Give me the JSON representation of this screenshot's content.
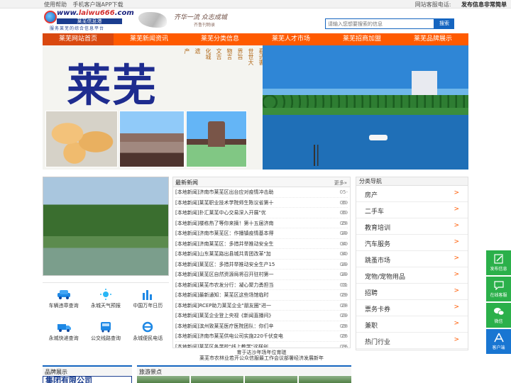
{
  "topbar": {
    "links": [
      "使用帮助",
      "手机客户端APP下载"
    ],
    "service_phone": "网站客服电话:",
    "post_info": "发布信息非常简单"
  },
  "logo": {
    "url_prefix": "www.",
    "url_domain": "laiwu666",
    "url_suffix": ".com",
    "name": "莱芜信息港",
    "slogan": "服务莱芜的综合信息平台"
  },
  "header_calligraphy": {
    "line1": "齐华一流 众志成城",
    "line2": "齐鲁刊物录"
  },
  "search": {
    "placeholder": "请输入您想要搜索的信息",
    "button": "搜索"
  },
  "nav": [
    "莱芜网站首页",
    "莱芜新闻资讯",
    "莱芜分类信息",
    "莱芜人才市场",
    "莱芜招商加盟",
    "莱芜品牌展示"
  ],
  "banner": {
    "title": "莱芜",
    "poem_columns": [
      "看诗書",
      "世世大",
      "界旨",
      "物言",
      "文吉",
      "化城",
      "遗",
      "产"
    ]
  },
  "services": [
    {
      "label": "车辆违章查询",
      "icon": "car-icon"
    },
    {
      "label": "永城天气预报",
      "icon": "weather-icon"
    },
    {
      "label": "中国万年日历",
      "icon": "calendar-chart-icon"
    },
    {
      "label": "永城快递查询",
      "icon": "delivery-truck-icon"
    },
    {
      "label": "公交线路查询",
      "icon": "bus-icon"
    },
    {
      "label": "永城便民电话",
      "icon": "ie-browser-icon"
    }
  ],
  "news": {
    "heading": "最新新闻",
    "more": "更多»",
    "items": [
      {
        "tag": "[本地新闻]",
        "title": "济南市莱芜区出台应对疫情冲击助",
        "date": "05-30"
      },
      {
        "tag": "[本地新闻]",
        "title": "莱芜职业技术学院师生陈议省第十",
        "date": "05-30"
      },
      {
        "tag": "[本地新闻]",
        "title": "扑汇莱芜中心交易深入开展\"优",
        "date": "05-28"
      },
      {
        "tag": "[本地新闻]",
        "title": "楼栋热了等你来摘！第十五届济南",
        "date": "05-29"
      },
      {
        "tag": "[本地新闻]",
        "title": "济南市莱芜区：作播镇疫情基本得",
        "date": "04-30"
      },
      {
        "tag": "[本地新闻]",
        "title": "济南莱芜区：多措并举推动安全生",
        "date": "04-30"
      },
      {
        "tag": "[本地新闻]",
        "title": "山东莱芜路出县城共青团改革\"加",
        "date": "04-29"
      },
      {
        "tag": "[本地新闻]",
        "title": "莱芜区：多措并举推动安全生产15",
        "date": "04-29"
      },
      {
        "tag": "[本地新闻]",
        "title": "莱芜区自然资源局将召开驻村第一",
        "date": "04-01"
      },
      {
        "tag": "[本地新闻]",
        "title": "莱芜市农发分行：凝心聚力勇担当",
        "date": "03-29"
      },
      {
        "tag": "[本地新闻]",
        "title": "最新通知：莱芜区这些场馆临时",
        "date": "03-28"
      },
      {
        "tag": "[本地新闻]",
        "title": "RCEP助力莱芜企业\"朋友圈\"进一",
        "date": "03-29"
      },
      {
        "tag": "[本地新闻]",
        "title": "莱芜企业登上央视《新闻直播间》",
        "date": "03-28"
      },
      {
        "tag": "[本地新闻]",
        "title": "滨州致莱芜医疗医院团队：你们辛",
        "date": "03-26"
      },
      {
        "tag": "[本地新闻]",
        "title": "济南市莱芜供电公司实施220千伏变电",
        "date": "03-26"
      },
      {
        "tag": "[本地新闻]",
        "title": "莱芜区各学校\"线上教学\"这样创",
        "date": "03-25"
      }
    ]
  },
  "notice": {
    "line1": "育于达沙年场年位育琏",
    "line2": "莱芜市农林业若开公众信服最工作会议部署经济发展新年"
  },
  "categories": {
    "heading": "分类导航",
    "items": [
      "房产",
      "二手车",
      "教育培训",
      "汽车服务",
      "跳蚤市场",
      "宠物/宠物用品",
      "招聘",
      "票务卡券",
      "兼职",
      "热门行业"
    ],
    "arrow": ">"
  },
  "float_bar": [
    {
      "label": "发布信息",
      "icon": "edit-icon"
    },
    {
      "label": "在线客服",
      "icon": "chat-bubble-icon"
    },
    {
      "label": "微信",
      "icon": "wechat-icon"
    },
    {
      "label": "客户端",
      "icon": "app-store-icon"
    }
  ],
  "bottom": {
    "brand_heading": "品牌展示",
    "brand_banner": "集团有限公司",
    "scenic_heading": "旅游景点"
  },
  "colors": {
    "nav_orange": "#ff5a00",
    "brand_blue": "#1565c0",
    "float_green": "#2bb04a"
  }
}
